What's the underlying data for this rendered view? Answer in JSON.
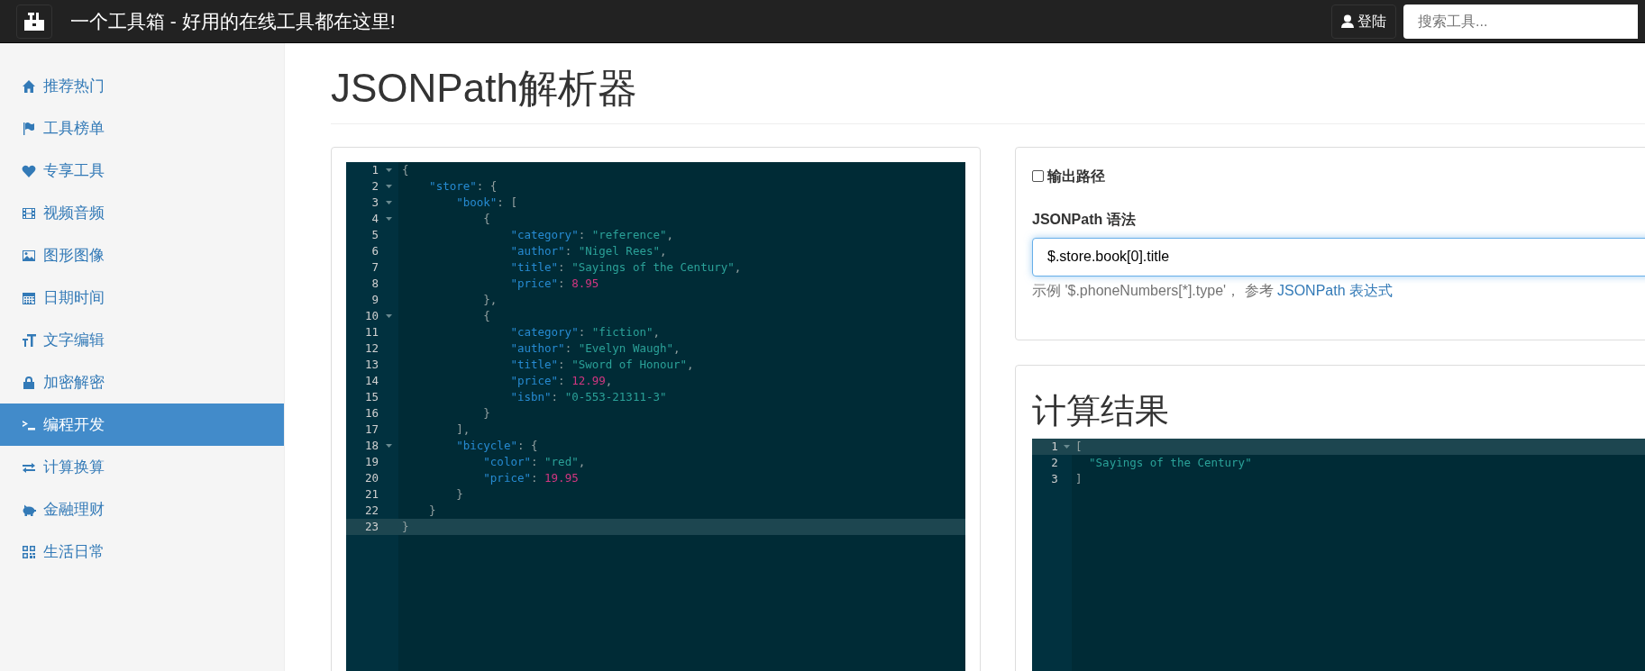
{
  "navbar": {
    "title": "一个工具箱 - 好用的在线工具都在这里!",
    "login": "登陆",
    "search": {
      "placeholder": "搜索工具..."
    }
  },
  "sidebar": {
    "items": [
      {
        "label": "推荐热门",
        "selected": false
      },
      {
        "label": "工具榜单",
        "selected": false
      },
      {
        "label": "专享工具",
        "selected": false
      },
      {
        "label": "视频音频",
        "selected": false
      },
      {
        "label": "图形图像",
        "selected": false
      },
      {
        "label": "日期时间",
        "selected": false
      },
      {
        "label": "文字编辑",
        "selected": false
      },
      {
        "label": "加密解密",
        "selected": false
      },
      {
        "label": "编程开发",
        "selected": true
      },
      {
        "label": "计算换算",
        "selected": false
      },
      {
        "label": "金融理财",
        "selected": false
      },
      {
        "label": "生活日常",
        "selected": false
      }
    ]
  },
  "page_title": "JSONPath解析器",
  "editor": {
    "lines": [
      {
        "number": "1",
        "foldable": true,
        "active": false,
        "tokens": [
          {
            "kind": "punct",
            "text": "{"
          }
        ]
      },
      {
        "number": "2",
        "foldable": true,
        "active": false,
        "tokens": [
          {
            "kind": "key",
            "text": "    \"store\""
          },
          {
            "kind": "punct",
            "text": ": {"
          }
        ]
      },
      {
        "number": "3",
        "foldable": true,
        "active": false,
        "tokens": [
          {
            "kind": "key",
            "text": "        \"book\""
          },
          {
            "kind": "punct",
            "text": ": ["
          }
        ]
      },
      {
        "number": "4",
        "foldable": true,
        "active": false,
        "tokens": [
          {
            "kind": "punct",
            "text": "            {"
          }
        ]
      },
      {
        "number": "5",
        "foldable": false,
        "active": false,
        "tokens": [
          {
            "kind": "key",
            "text": "                \"category\""
          },
          {
            "kind": "punct",
            "text": ": "
          },
          {
            "kind": "string",
            "text": "\"reference\""
          },
          {
            "kind": "punct",
            "text": ","
          }
        ]
      },
      {
        "number": "6",
        "foldable": false,
        "active": false,
        "tokens": [
          {
            "kind": "key",
            "text": "                \"author\""
          },
          {
            "kind": "punct",
            "text": ": "
          },
          {
            "kind": "string",
            "text": "\"Nigel Rees\""
          },
          {
            "kind": "punct",
            "text": ","
          }
        ]
      },
      {
        "number": "7",
        "foldable": false,
        "active": false,
        "tokens": [
          {
            "kind": "key",
            "text": "                \"title\""
          },
          {
            "kind": "punct",
            "text": ": "
          },
          {
            "kind": "string",
            "text": "\"Sayings of the Century\""
          },
          {
            "kind": "punct",
            "text": ","
          }
        ]
      },
      {
        "number": "8",
        "foldable": false,
        "active": false,
        "tokens": [
          {
            "kind": "key",
            "text": "                \"price\""
          },
          {
            "kind": "punct",
            "text": ": "
          },
          {
            "kind": "number",
            "text": "8.95"
          }
        ]
      },
      {
        "number": "9",
        "foldable": false,
        "active": false,
        "tokens": [
          {
            "kind": "punct",
            "text": "            },"
          }
        ]
      },
      {
        "number": "10",
        "foldable": true,
        "active": false,
        "tokens": [
          {
            "kind": "punct",
            "text": "            {"
          }
        ]
      },
      {
        "number": "11",
        "foldable": false,
        "active": false,
        "tokens": [
          {
            "kind": "key",
            "text": "                \"category\""
          },
          {
            "kind": "punct",
            "text": ": "
          },
          {
            "kind": "string",
            "text": "\"fiction\""
          },
          {
            "kind": "punct",
            "text": ","
          }
        ]
      },
      {
        "number": "12",
        "foldable": false,
        "active": false,
        "tokens": [
          {
            "kind": "key",
            "text": "                \"author\""
          },
          {
            "kind": "punct",
            "text": ": "
          },
          {
            "kind": "string",
            "text": "\"Evelyn Waugh\""
          },
          {
            "kind": "punct",
            "text": ","
          }
        ]
      },
      {
        "number": "13",
        "foldable": false,
        "active": false,
        "tokens": [
          {
            "kind": "key",
            "text": "                \"title\""
          },
          {
            "kind": "punct",
            "text": ": "
          },
          {
            "kind": "string",
            "text": "\"Sword of Honour\""
          },
          {
            "kind": "punct",
            "text": ","
          }
        ]
      },
      {
        "number": "14",
        "foldable": false,
        "active": false,
        "tokens": [
          {
            "kind": "key",
            "text": "                \"price\""
          },
          {
            "kind": "punct",
            "text": ": "
          },
          {
            "kind": "number",
            "text": "12.99"
          },
          {
            "kind": "punct",
            "text": ","
          }
        ]
      },
      {
        "number": "15",
        "foldable": false,
        "active": false,
        "tokens": [
          {
            "kind": "key",
            "text": "                \"isbn\""
          },
          {
            "kind": "punct",
            "text": ": "
          },
          {
            "kind": "string",
            "text": "\"0-553-21311-3\""
          }
        ]
      },
      {
        "number": "16",
        "foldable": false,
        "active": false,
        "tokens": [
          {
            "kind": "punct",
            "text": "            }"
          }
        ]
      },
      {
        "number": "17",
        "foldable": false,
        "active": false,
        "tokens": [
          {
            "kind": "punct",
            "text": "        ],"
          }
        ]
      },
      {
        "number": "18",
        "foldable": true,
        "active": false,
        "tokens": [
          {
            "kind": "key",
            "text": "        \"bicycle\""
          },
          {
            "kind": "punct",
            "text": ": {"
          }
        ]
      },
      {
        "number": "19",
        "foldable": false,
        "active": false,
        "tokens": [
          {
            "kind": "key",
            "text": "            \"color\""
          },
          {
            "kind": "punct",
            "text": ": "
          },
          {
            "kind": "string",
            "text": "\"red\""
          },
          {
            "kind": "punct",
            "text": ","
          }
        ]
      },
      {
        "number": "20",
        "foldable": false,
        "active": false,
        "tokens": [
          {
            "kind": "key",
            "text": "            \"price\""
          },
          {
            "kind": "punct",
            "text": ": "
          },
          {
            "kind": "number",
            "text": "19.95"
          }
        ]
      },
      {
        "number": "21",
        "foldable": false,
        "active": false,
        "tokens": [
          {
            "kind": "punct",
            "text": "        }"
          }
        ]
      },
      {
        "number": "22",
        "foldable": false,
        "active": false,
        "tokens": [
          {
            "kind": "punct",
            "text": "    }"
          }
        ]
      },
      {
        "number": "23",
        "foldable": false,
        "active": true,
        "tokens": [
          {
            "kind": "punct",
            "text": "}"
          }
        ]
      }
    ]
  },
  "options": {
    "output_path": {
      "label": "输出路径",
      "checked": false
    },
    "syntax": {
      "label": "JSONPath 语法",
      "value": "$.store.book[0].title",
      "help": "示例 '$.phoneNumbers[*].type'， 参考 ",
      "link": "JSONPath 表达式"
    }
  },
  "result": {
    "title": "计算结果",
    "lines": [
      {
        "number": "1",
        "foldable": true,
        "active": true,
        "tokens": [
          {
            "kind": "punct",
            "text": "["
          }
        ]
      },
      {
        "number": "2",
        "foldable": false,
        "active": false,
        "tokens": [
          {
            "kind": "string",
            "text": "  \"Sayings of the Century\""
          }
        ]
      },
      {
        "number": "3",
        "foldable": false,
        "active": false,
        "tokens": [
          {
            "kind": "punct",
            "text": "]"
          }
        ]
      }
    ]
  }
}
